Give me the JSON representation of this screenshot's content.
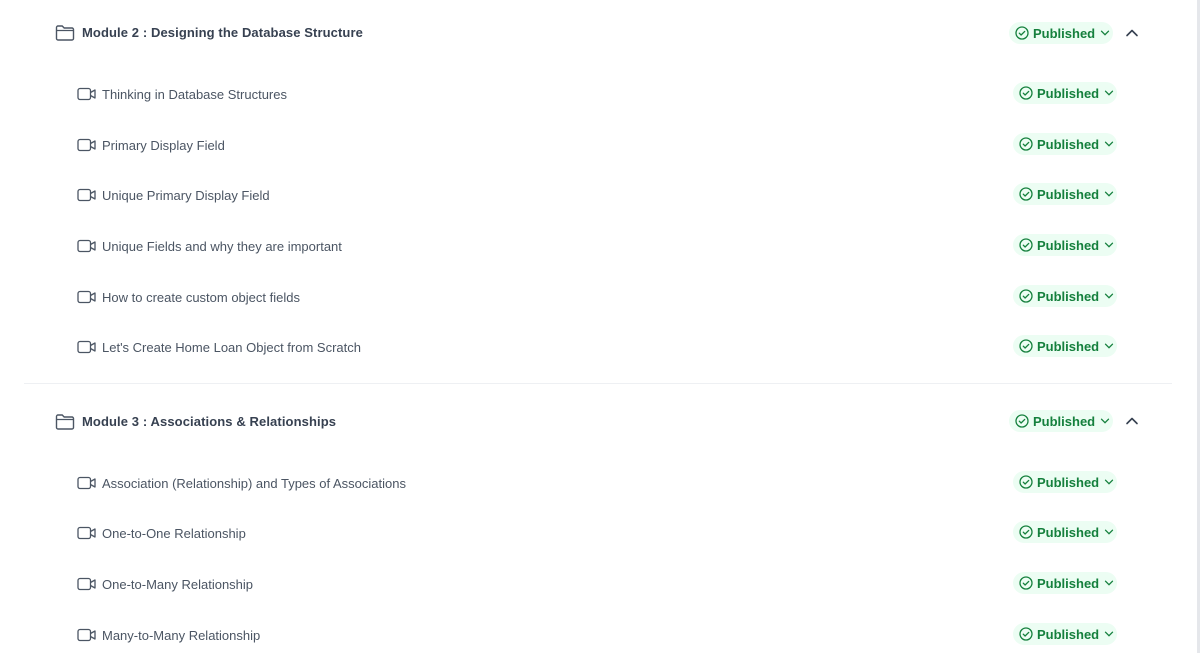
{
  "modules": [
    {
      "title": "Module 2 : Designing the Database Structure",
      "status": "Published",
      "lessons": [
        {
          "title": "Thinking in Database Structures",
          "status": "Published"
        },
        {
          "title": "Primary Display Field",
          "status": "Published"
        },
        {
          "title": "Unique Primary Display Field",
          "status": "Published"
        },
        {
          "title": "Unique Fields and why they are important",
          "status": "Published"
        },
        {
          "title": "How to create custom object fields",
          "status": "Published"
        },
        {
          "title": "Let's Create Home Loan Object from Scratch",
          "status": "Published"
        }
      ]
    },
    {
      "title": "Module 3 : Associations & Relationships",
      "status": "Published",
      "lessons": [
        {
          "title": "Association (Relationship) and Types of Associations",
          "status": "Published"
        },
        {
          "title": "One-to-One Relationship",
          "status": "Published"
        },
        {
          "title": "One-to-Many Relationship",
          "status": "Published"
        },
        {
          "title": "Many-to-Many Relationship",
          "status": "Published"
        }
      ]
    }
  ],
  "icons": {
    "module": "folder-icon",
    "lesson": "video-icon",
    "status": "check-circle-icon",
    "status_dropdown": "chevron-down-icon",
    "collapse": "chevron-up-icon"
  },
  "colors": {
    "published_text": "#15803d",
    "published_bg": "#ecfdf3",
    "text": "#374151",
    "divider": "#eef0f3"
  }
}
